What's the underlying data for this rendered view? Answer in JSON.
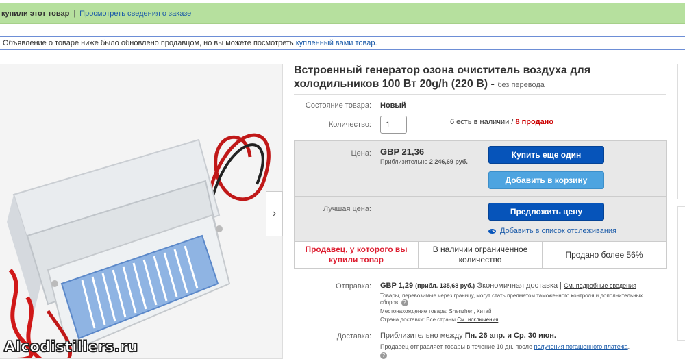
{
  "banner": {
    "purchased_text": "купили этот товар",
    "separator": "|",
    "order_link": "Просмотреть сведения о заказе"
  },
  "notice": {
    "text": "Объявление о товаре ниже было обновлено продавцом, но вы можете посмотреть ",
    "link": "купленный вами товар",
    "tail": "."
  },
  "gallery": {
    "next_arrow": "›",
    "watermark": "Alcodistillers.ru"
  },
  "product": {
    "title": "Встроенный генератор озона очиститель воздуха для холодильников 100 Вт 20g/h (220 В) -",
    "no_translation": "без перевода",
    "condition_label": "Состояние товара:",
    "condition_value": "Новый",
    "quantity_label": "Количество:",
    "quantity_value": "1",
    "availability": "6 есть в наличии /",
    "sold_link": "8 продано"
  },
  "price": {
    "label": "Цена:",
    "value": "GBP 21,36",
    "approx_label": "Приблизительно",
    "approx_value": "2 246,69 руб.",
    "buy_again": "Купить еще один",
    "add_to_cart": "Добавить в корзину",
    "best_offer_label": "Лучшая цена:",
    "make_offer": "Предложить цену",
    "watch": "Добавить в список отслеживания"
  },
  "badges": {
    "seller": "Продавец, у которого вы купили товар",
    "limited": "В наличии ограниченное количество",
    "sold_pct": "Продано более 56%"
  },
  "shipping": {
    "label": "Отправка:",
    "price": "GBP 1,29",
    "approx": "(прибл. 135,68 руб.)",
    "method": "Экономичная доставка |",
    "details_link": "См. подробные сведения",
    "customs_note": "Товары, перевозимые через границу, могут стать предметом таможенного контроля и дополнительных сборов.",
    "location": "Местонахождение товара:  Shenzhen, Китай",
    "ship_to": "Страна доставки:  Все страны",
    "exclusions_link": "См. исключения"
  },
  "delivery": {
    "label": "Доставка:",
    "text": "Приблизительно между",
    "dates": "Пн. 26 апр. и Ср. 30 июн.",
    "handling": "Продавец отправляет товары в течение 10 дн. после",
    "payment_link": "получения погашенного платежа",
    "tail": "."
  },
  "colors": {
    "banner_bg": "#b6e09e",
    "primary_btn": "#0654ba",
    "secondary_btn": "#4ea4e0",
    "alert_red": "#dd1e31"
  }
}
